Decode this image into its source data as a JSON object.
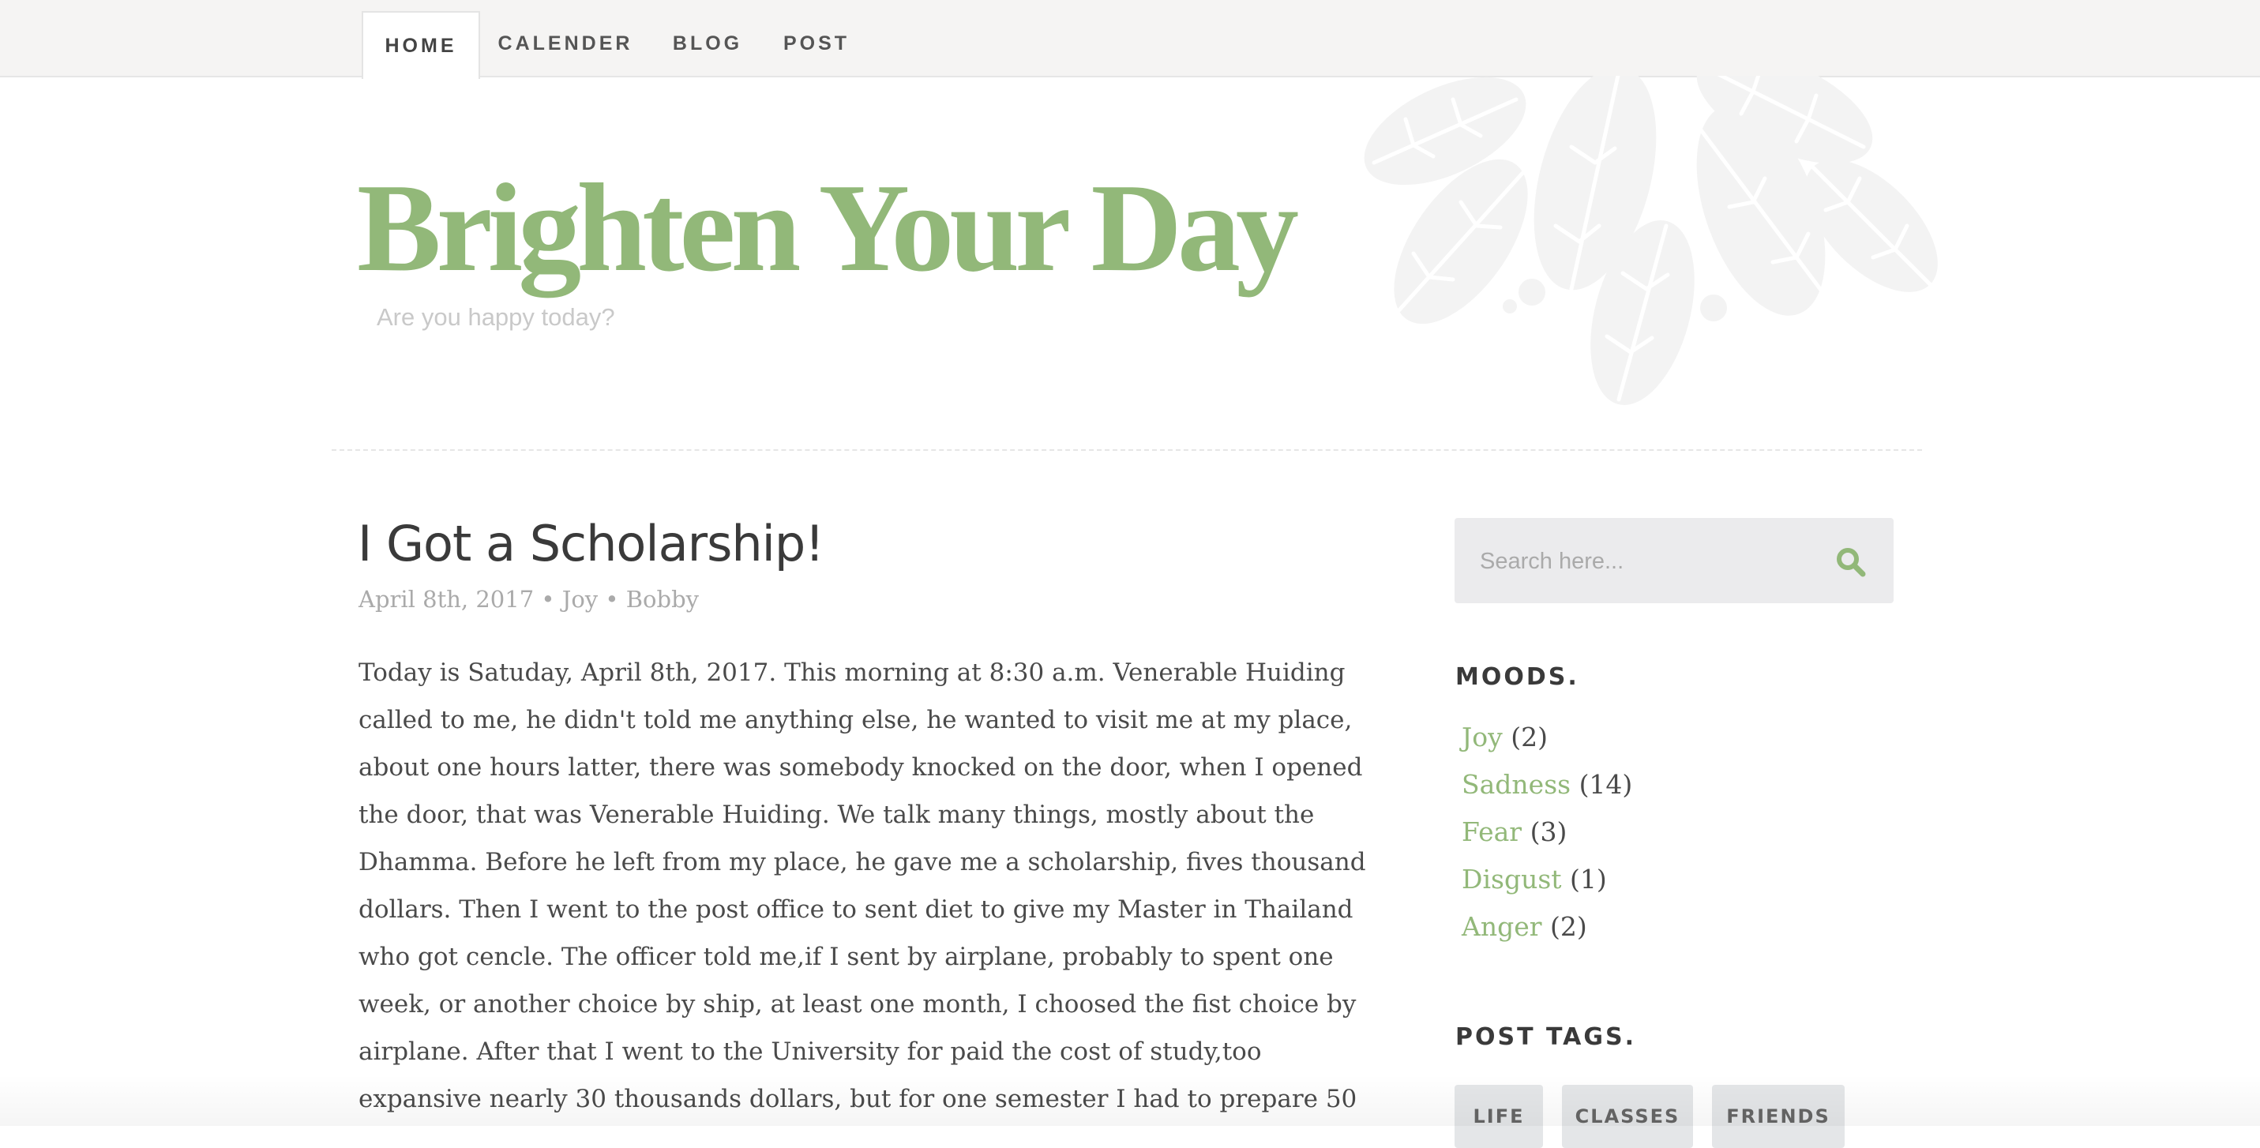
{
  "nav": {
    "items": [
      {
        "label": "HOME",
        "active": true
      },
      {
        "label": "CALENDER",
        "active": false
      },
      {
        "label": "BLOG",
        "active": false
      },
      {
        "label": "POST",
        "active": false
      }
    ]
  },
  "header": {
    "title": "Brighten Your Day",
    "tagline": "Are you happy today?",
    "decoration_icon": "leaf-cluster-icon"
  },
  "post": {
    "title": "I Got a Scholarship!",
    "meta": {
      "date": "April 8th, 2017",
      "separator": " • ",
      "mood": "Joy",
      "author": "Bobby"
    },
    "body_lines": [
      "Today is Satuday, April 8th, 2017. This morning at 8:30 a.m. Venerable Huiding",
      "called to me, he didn't told me anything else, he wanted to visit me at my place,",
      "about one hours latter, there was somebody knocked on the door, when I opened",
      "the door, that was Venerable Huiding. We talk many things, mostly about the",
      "Dhamma. Before he left from my place, he gave me a scholarship, fives thousand",
      "dollars. Then I went to the post office to sent diet to give my Master in Thailand",
      "who got cencle. The officer told me,if I sent by airplane, probably to spent one",
      "week, or another choice by ship, at least one month, I choosed the fist choice by",
      "airplane. After that I went to the University for paid the cost of study,too",
      "expansive nearly 30 thousands dollars, but for one semester I had to prepare 50"
    ]
  },
  "sidebar": {
    "search": {
      "placeholder": "Search here...",
      "icon": "search-icon"
    },
    "moods": {
      "title": "MOODS.",
      "items": [
        {
          "label": "Joy",
          "count": "(2)"
        },
        {
          "label": "Sadness",
          "count": "(14)"
        },
        {
          "label": "Fear",
          "count": "(3)"
        },
        {
          "label": "Disgust",
          "count": "(1)"
        },
        {
          "label": "Anger",
          "count": "(2)"
        }
      ]
    },
    "tags": {
      "title": "POST TAGS.",
      "items": [
        "LIFE",
        "CLASSES",
        "FRIENDS"
      ]
    }
  },
  "colors": {
    "accent": "#92b879",
    "nav_bg": "#f5f4f3",
    "text": "#4a4a4a",
    "muted": "#aaaaaa",
    "search_bg": "#ebebed",
    "tag_bg": "#e4e6e8"
  }
}
